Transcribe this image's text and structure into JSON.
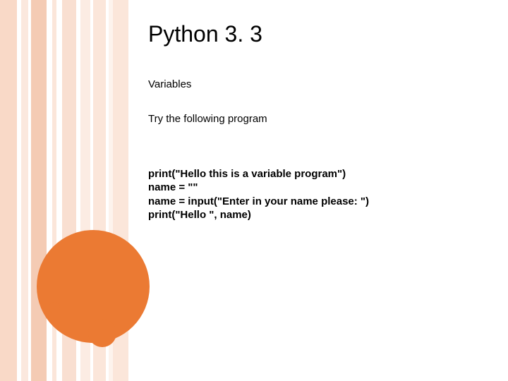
{
  "title": "Python 3. 3",
  "subtitle": "Variables",
  "instruction": "Try the following program",
  "code_lines": [
    "print(\"Hello this is a variable program\")",
    "name = \"\"",
    "name = input(\"Enter in your name please: \")",
    "print(\"Hello \", name)"
  ]
}
